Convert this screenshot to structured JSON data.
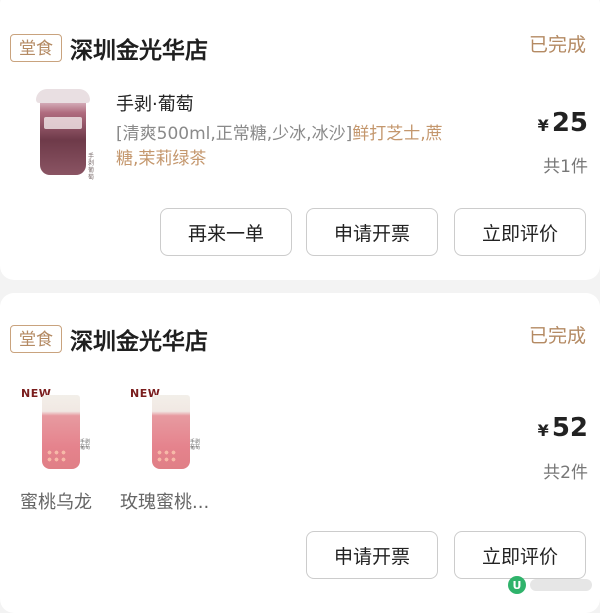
{
  "orders": [
    {
      "tag": "堂食",
      "store": "深圳金光华店",
      "status": "已完成",
      "item": {
        "name": "手剥·葡萄",
        "spec_plain": "[清爽500ml,正常糖,少冰,冰沙]",
        "spec_extra_1": "鲜打芝士,蔗",
        "spec_extra_2": "糖,茉莉绿茶"
      },
      "price_symbol": "¥",
      "price": "25",
      "qty": "共1件",
      "buttons": {
        "reorder": "再来一单",
        "invoice": "申请开票",
        "review": "立即评价"
      }
    },
    {
      "tag": "堂食",
      "store": "深圳金光华店",
      "status": "已完成",
      "items": [
        {
          "badge": "NEW",
          "name": "蜜桃乌龙"
        },
        {
          "badge": "NEW",
          "name": "玫瑰蜜桃..."
        }
      ],
      "price_symbol": "¥",
      "price": "52",
      "qty": "共2件",
      "buttons": {
        "invoice": "申请开票",
        "review": "立即评价"
      }
    }
  ],
  "icons": {
    "watermark": "u-logo-icon"
  }
}
